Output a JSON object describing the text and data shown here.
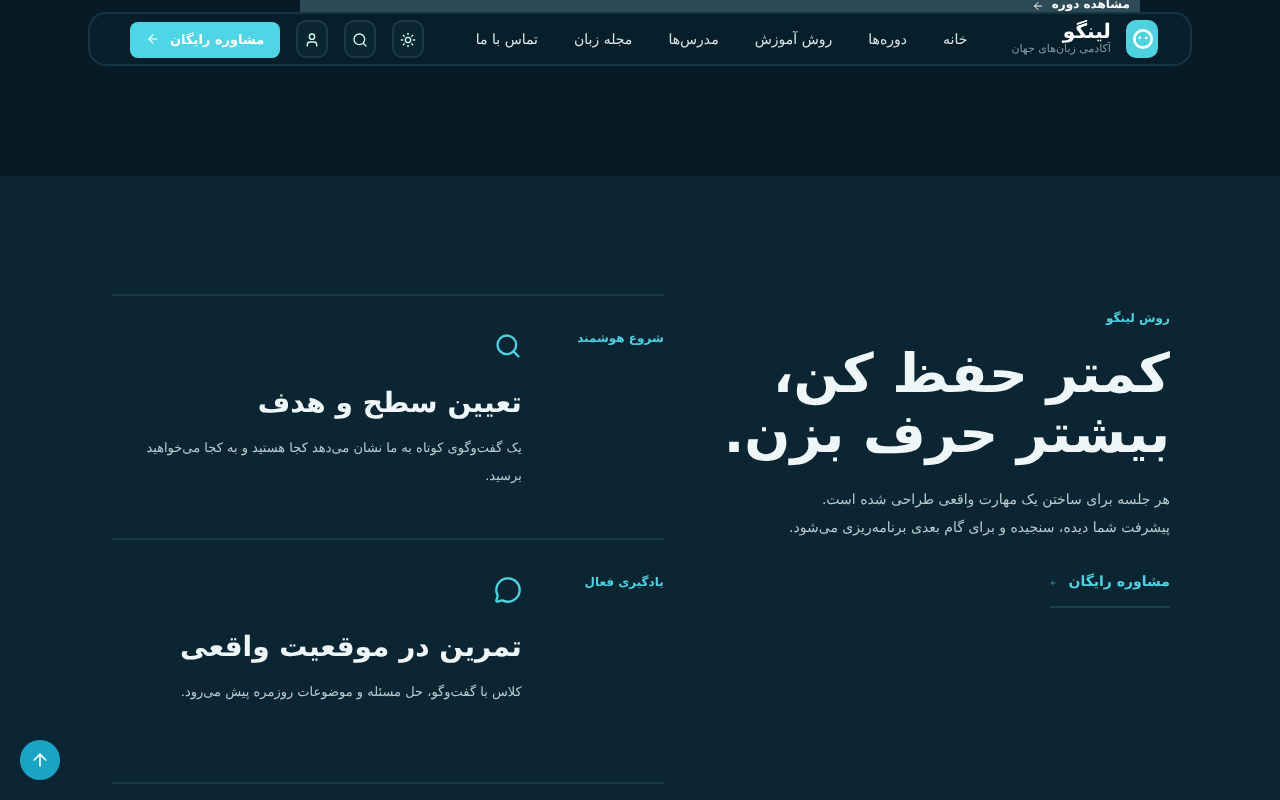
{
  "top_strip": {
    "link": "مشاهده دوره"
  },
  "navbar": {
    "brand": {
      "name": "لینگو",
      "tagline": "آکادمی زبان‌های جهان"
    },
    "links": [
      "خانه",
      "دوره‌ها",
      "روش آموزش",
      "مدرس‌ها",
      "مجله زبان",
      "تماس با ما"
    ],
    "cta": "مشاوره رایگان"
  },
  "hero": {
    "eyebrow": "روش لینگو",
    "headline": [
      "کمتر حفظ کن،",
      "بیشتر حرف بزن."
    ],
    "body": [
      "هر جلسه برای ساختن یک مهارت واقعی طراحی شده است.",
      "پیشرفت شما دیده، سنجیده و برای گام بعدی برنامه‌ریزی می‌شود."
    ],
    "link": "مشاوره رایگان"
  },
  "steps": [
    {
      "kind": "search",
      "tag": "شروع هوشمند",
      "title": "تعیین سطح و هدف",
      "text": "یک گفت‌وگوی کوتاه به ما نشان می‌دهد کجا هستید و به کجا می‌خواهید برسید."
    },
    {
      "kind": "chat",
      "tag": "یادگیری فعال",
      "title": "تمرین در موقعیت واقعی",
      "text": "کلاس با گفت‌وگو، حل مسئله و موضوعات روزمره پیش می‌رود."
    }
  ]
}
